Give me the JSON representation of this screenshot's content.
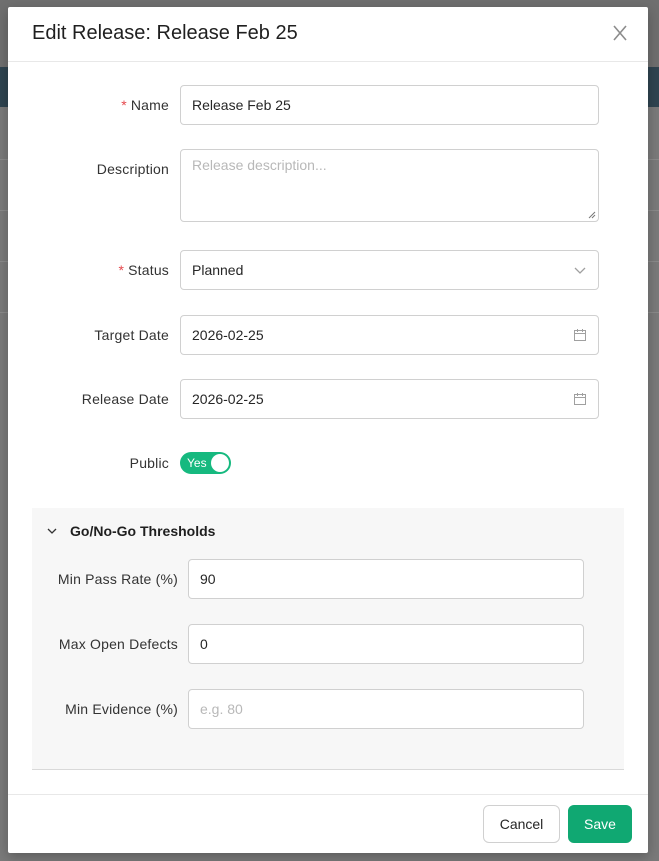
{
  "modal": {
    "title": "Edit Release: Release Feb 25",
    "close_icon": "close-icon"
  },
  "form": {
    "name": {
      "label": "Name",
      "required": true,
      "value": "Release Feb 25"
    },
    "description": {
      "label": "Description",
      "placeholder": "Release description...",
      "value": ""
    },
    "status": {
      "label": "Status",
      "required": true,
      "value": "Planned",
      "icon": "chevron-down-icon"
    },
    "target_date": {
      "label": "Target Date",
      "value": "2026-02-25",
      "icon": "calendar-icon"
    },
    "release_date": {
      "label": "Release Date",
      "value": "2026-02-25",
      "icon": "calendar-icon"
    },
    "public": {
      "label": "Public",
      "toggle_text": "Yes",
      "checked": true
    }
  },
  "thresholds": {
    "title": "Go/No-Go Thresholds",
    "icon": "chevron-down-icon",
    "min_pass_rate": {
      "label": "Min Pass Rate (%)",
      "value": "90"
    },
    "max_open_defects": {
      "label": "Max Open Defects",
      "value": "0"
    },
    "min_evidence": {
      "label": "Min Evidence (%)",
      "placeholder": "e.g. 80",
      "value": ""
    }
  },
  "footer": {
    "cancel_label": "Cancel",
    "save_label": "Save"
  },
  "colors": {
    "accent": "#10a872",
    "toggle_on": "#16b97f",
    "required": "#e5484d",
    "overlay": "#6f6f6f"
  }
}
